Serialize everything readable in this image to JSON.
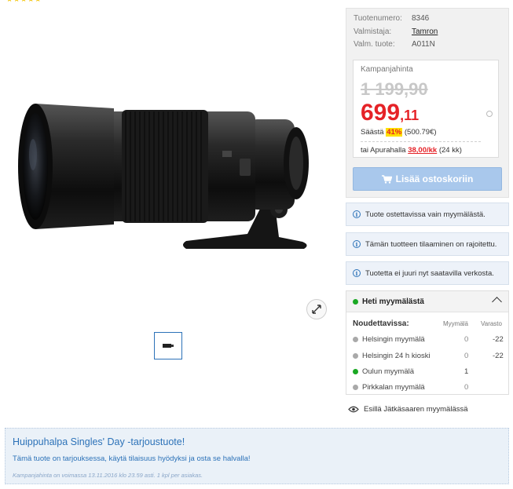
{
  "rating_stars": "★★★★★",
  "product": {
    "info": [
      {
        "label": "Tuotenumero:",
        "value": "8346",
        "link": false
      },
      {
        "label": "Valmistaja:",
        "value": "Tamron",
        "link": true
      },
      {
        "label": "Valm. tuote:",
        "value": "A011N",
        "link": false
      }
    ],
    "thumbnail_icon": "lens-thumbnail-icon",
    "zoom_icon": "expand-arrows-icon"
  },
  "price": {
    "campaign_label": "Kampanjahinta",
    "old_price": "1 199,90",
    "new_price_main": "699",
    "new_price_cents": ",11",
    "savings_prefix": "Säästä",
    "savings_pct": "41%",
    "savings_amount": "(500.79€)",
    "installment_prefix": "tai Apurahalla",
    "installment_amount": "38,00/kk",
    "installment_period": "(24 kk)"
  },
  "cart": {
    "button_label": "Lisää ostoskoriin",
    "icon": "cart-icon"
  },
  "notices": [
    "Tuote ostettavissa vain myymälästä.",
    "Tämän tuotteen tilaaminen on rajoitettu.",
    "Tuotetta ei juuri nyt saatavilla verkosta."
  ],
  "availability": {
    "header": "Heti myymälästä",
    "col_title": "Noudettavissa:",
    "col_store": "Myymälä",
    "col_stock": "Varasto",
    "stores": [
      {
        "name": "Helsingin myymälä",
        "store": "0",
        "stock": "-22",
        "status": "grey"
      },
      {
        "name": "Helsingin 24 h kioski",
        "store": "0",
        "stock": "-22",
        "status": "grey"
      },
      {
        "name": "Oulun myymälä",
        "store": "1",
        "stock": "",
        "status": "green"
      },
      {
        "name": "Pirkkalan myymälä",
        "store": "0",
        "stock": "",
        "status": "grey"
      }
    ],
    "display_note": "Esillä Jätkäsaaren myymälässä"
  },
  "promo": {
    "title": "Huippuhalpa Singles' Day -tarjoustuote!",
    "text": "Tämä tuote on tarjouksessa, käytä tilaisuus hyödyksi ja osta se halvalla!",
    "footnote": "Kampanjahinta on voimassa 13.11.2016 klo 23.59 asti. 1 kpl per asiakas."
  },
  "colors": {
    "accent_blue": "#2c72b8",
    "price_red": "#e52227",
    "highlight_yellow": "#ffe000",
    "in_stock_green": "#1aa823"
  }
}
